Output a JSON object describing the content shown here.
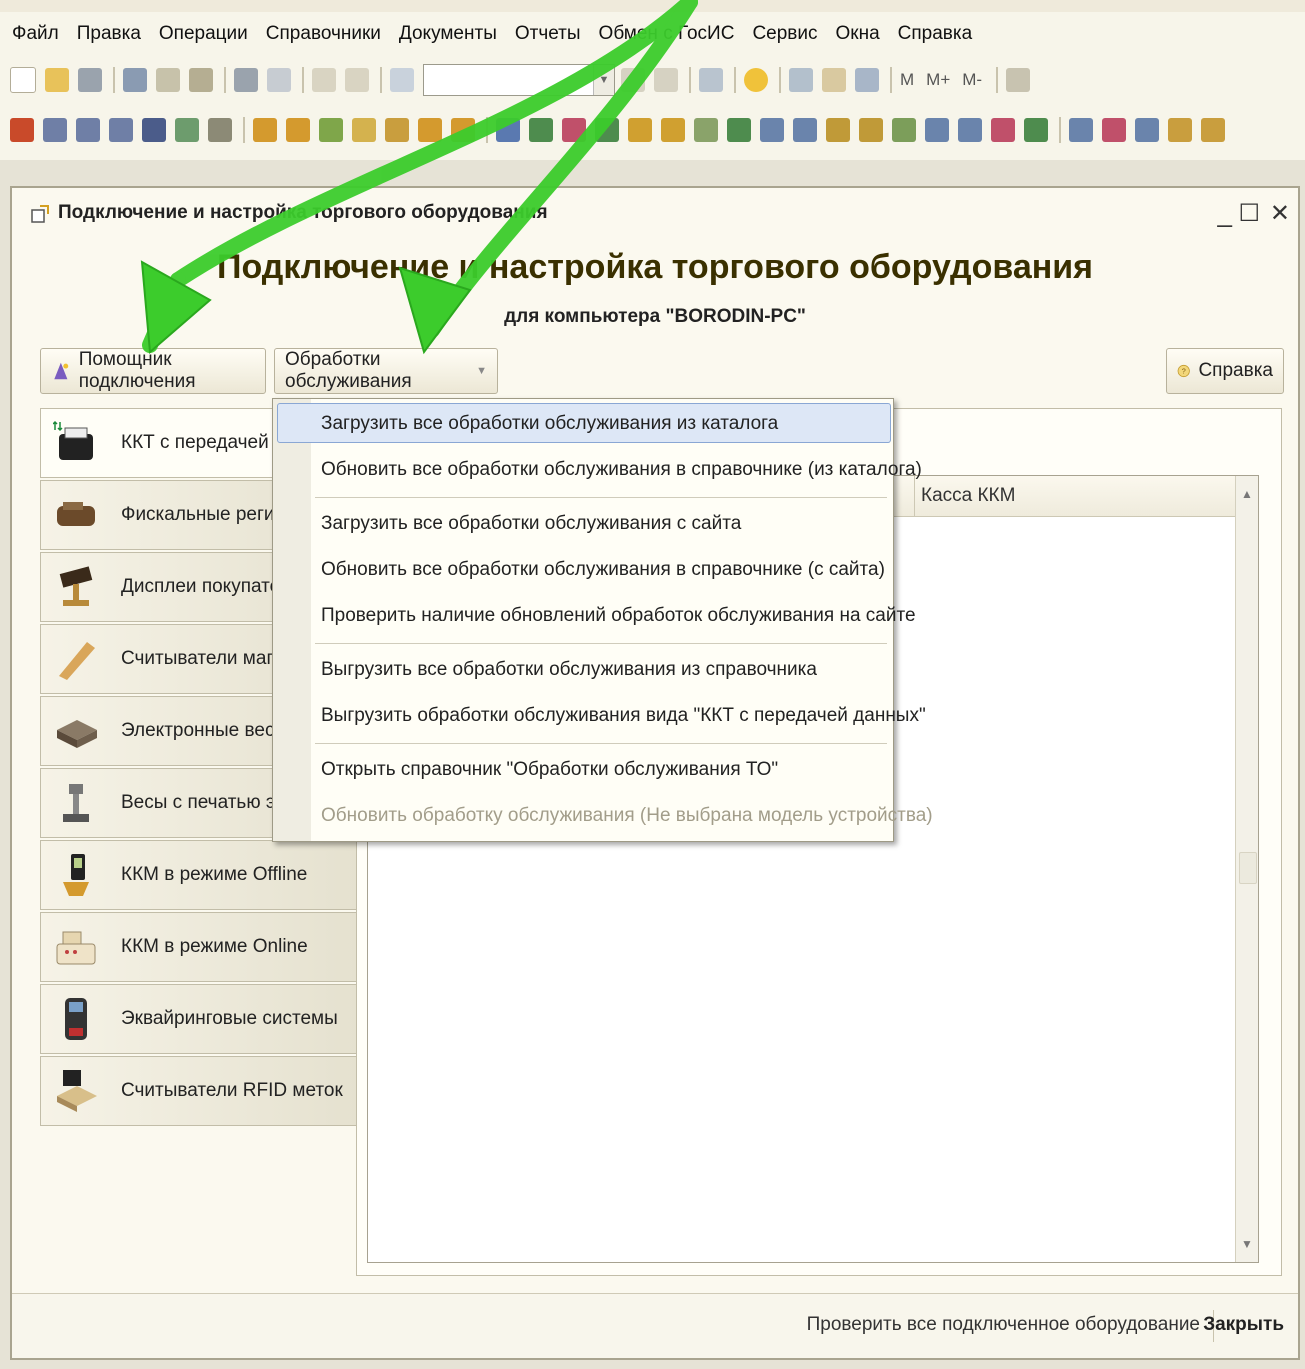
{
  "menubar": {
    "items": [
      "Файл",
      "Правка",
      "Операции",
      "Справочники",
      "Документы",
      "Отчеты",
      "Обмен с ГосИС",
      "Сервис",
      "Окна",
      "Справка"
    ]
  },
  "toolbar": {
    "memory_labels": [
      "M",
      "M+",
      "M-"
    ]
  },
  "window": {
    "title": "Подключение и настройка торгового оборудования",
    "heading": "Подключение и настройка торгового оборудования",
    "subtitle": "для компьютера \"BORODIN-PC\"",
    "buttons": {
      "assistant": "Помощник подключения",
      "service": "Обработки обслуживания",
      "help": "Справка"
    },
    "devices": [
      "ККТ с передачей дан",
      "Фискальные регистр",
      "Дисплеи покупателя",
      "Считыватели магнит",
      "Электронные весы",
      "Весы с печатью этик",
      "ККМ в режиме Offline",
      "ККМ в режиме Online",
      "Эквайринговые системы",
      "Считыватели RFID меток"
    ],
    "grid": {
      "column": "Касса ККМ"
    },
    "footer": {
      "check": "Проверить все подключенное оборудование",
      "close": "Закрыть"
    }
  },
  "dropdown": {
    "items": [
      "Загрузить все обработки обслуживания из каталога",
      "Обновить все обработки обслуживания в справочнике (из каталога)",
      "Загрузить все обработки обслуживания с сайта",
      "Обновить все обработки обслуживания в справочнике (с сайта)",
      "Проверить наличие обновлений обработок обслуживания на сайте",
      "Выгрузить все обработки обслуживания из справочника",
      "Выгрузить обработки обслуживания вида \"ККТ с передачей данных\"",
      "Открыть справочник \"Обработки обслуживания ТО\"",
      "Обновить обработку обслуживания (Не выбрана модель устройства)"
    ]
  },
  "colors": {
    "arrow": "#3ccc2c",
    "highlight": "#dde7f6",
    "window_bg": "#fbf9ef"
  }
}
